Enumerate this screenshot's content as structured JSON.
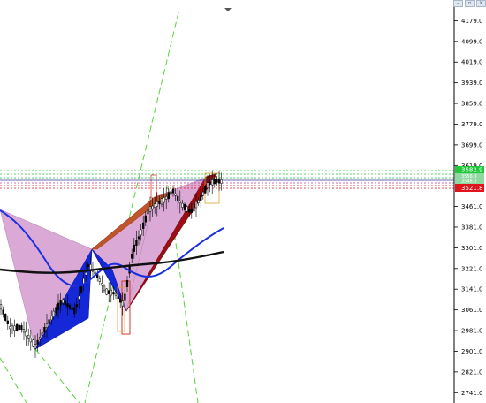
{
  "window": {
    "buttons": [
      {
        "label": "–",
        "icon": "minimize-icon"
      },
      {
        "label": "▫",
        "icon": "restore-icon"
      },
      {
        "label": "×",
        "icon": "close-icon"
      }
    ]
  },
  "price_axis": {
    "ticks": [
      "4179.0",
      "4099.0",
      "4019.0",
      "3939.0",
      "3859.0",
      "3779.0",
      "3699.0",
      "3619.0",
      "3461.0",
      "3381.0",
      "3301.0",
      "3221.0",
      "3141.0",
      "3061.0",
      "2981.0",
      "2901.0",
      "2821.0",
      "2741.0"
    ],
    "badge_green": "3582.9",
    "badge_red": "3521.8",
    "badge_mid": [
      "3556.9",
      "3548.3"
    ]
  },
  "colors": {
    "background": "#ffffff",
    "pattern_pink": "#dba9d6",
    "pattern_blue": "#1428d8",
    "pattern_darkred": "#9b0f14",
    "pattern_orange_red": "#c0542a",
    "ma_blue": "#1a30e0",
    "ma_black": "#111111",
    "badge_green": "#1fc83a",
    "badge_red": "#e0141c",
    "guide_green": "#5ad23a"
  },
  "chart_data": {
    "type": "candlestick",
    "title": "",
    "ylim": [
      2701.0,
      4259.0
    ],
    "bid_price": 3556.9,
    "ask_price": 3548.3,
    "last_high": 3582.9,
    "last_low": 3521.8,
    "indicators": [
      "blue moving average",
      "black moving average",
      "harmonic pattern overlays"
    ]
  }
}
